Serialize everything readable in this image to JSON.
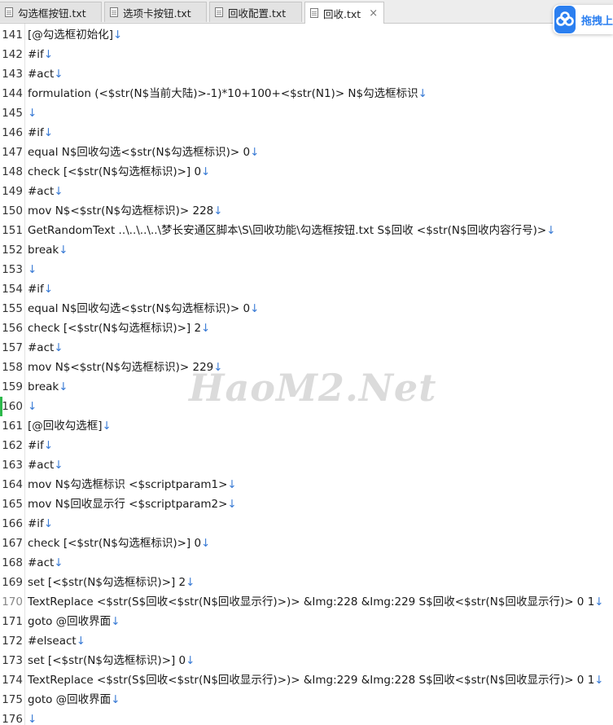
{
  "tabs": [
    {
      "label": "勾选框按钮.txt",
      "active": false
    },
    {
      "label": "选项卡按钮.txt",
      "active": false
    },
    {
      "label": "回收配置.txt",
      "active": false
    },
    {
      "label": "回收.txt",
      "active": true,
      "close": "×"
    }
  ],
  "baidu": {
    "label": "拖拽上"
  },
  "eol_marker": "↓",
  "lines": [
    {
      "num": "141",
      "text": "[@勾选框初始化]"
    },
    {
      "num": "142",
      "text": "#if"
    },
    {
      "num": "143",
      "text": "#act"
    },
    {
      "num": "144",
      "text": "formulation (<$str(N$当前大陆)>-1)*10+100+<$str(N1)> N$勾选框标识"
    },
    {
      "num": "145",
      "text": ""
    },
    {
      "num": "146",
      "text": "#if"
    },
    {
      "num": "147",
      "text": "equal N$回收勾选<$str(N$勾选框标识)> 0"
    },
    {
      "num": "148",
      "text": "check [<$str(N$勾选框标识)>] 0"
    },
    {
      "num": "149",
      "text": "#act"
    },
    {
      "num": "150",
      "text": "mov N$<$str(N$勾选框标识)> 228"
    },
    {
      "num": "151",
      "text": "GetRandomText ..\\..\\..\\..\\梦长安通区脚本\\S\\回收功能\\勾选框按钮.txt S$回收 <$str(N$回收内容行号)>"
    },
    {
      "num": "152",
      "text": "break"
    },
    {
      "num": "153",
      "text": ""
    },
    {
      "num": "154",
      "text": "#if"
    },
    {
      "num": "155",
      "text": "equal N$回收勾选<$str(N$勾选框标识)> 0"
    },
    {
      "num": "156",
      "text": "check [<$str(N$勾选框标识)>] 2"
    },
    {
      "num": "157",
      "text": "#act"
    },
    {
      "num": "158",
      "text": "mov N$<$str(N$勾选框标识)> 229"
    },
    {
      "num": "159",
      "text": "break"
    },
    {
      "num": "160",
      "text": ""
    },
    {
      "num": "161",
      "text": "[@回收勾选框]"
    },
    {
      "num": "162",
      "text": "#if"
    },
    {
      "num": "163",
      "text": "#act"
    },
    {
      "num": "164",
      "text": "mov N$勾选框标识 <$scriptparam1>"
    },
    {
      "num": "165",
      "text": "mov N$回收显示行 <$scriptparam2>"
    },
    {
      "num": "166",
      "text": "#if"
    },
    {
      "num": "167",
      "text": "check [<$str(N$勾选框标识)>] 0"
    },
    {
      "num": "168",
      "text": "#act"
    },
    {
      "num": "169",
      "text": "set [<$str(N$勾选框标识)>] 2"
    },
    {
      "num": "170",
      "text": "TextReplace <$str(S$回收<$str(N$回收显示行)>)> &Img:228 &Img:229 S$回收<$str(N$回收显示行)> 0 1"
    },
    {
      "num": "171",
      "text": "goto @回收界面"
    },
    {
      "num": "172",
      "text": "#elseact"
    },
    {
      "num": "173",
      "text": "set [<$str(N$勾选框标识)>] 0"
    },
    {
      "num": "174",
      "text": "TextReplace <$str(S$回收<$str(N$回收显示行)>)> &Img:229 &Img:228 S$回收<$str(N$回收显示行)> 0 1"
    },
    {
      "num": "175",
      "text": "goto @回收界面"
    },
    {
      "num": "176",
      "text": ""
    }
  ],
  "watermark": "HaoM2.Net"
}
